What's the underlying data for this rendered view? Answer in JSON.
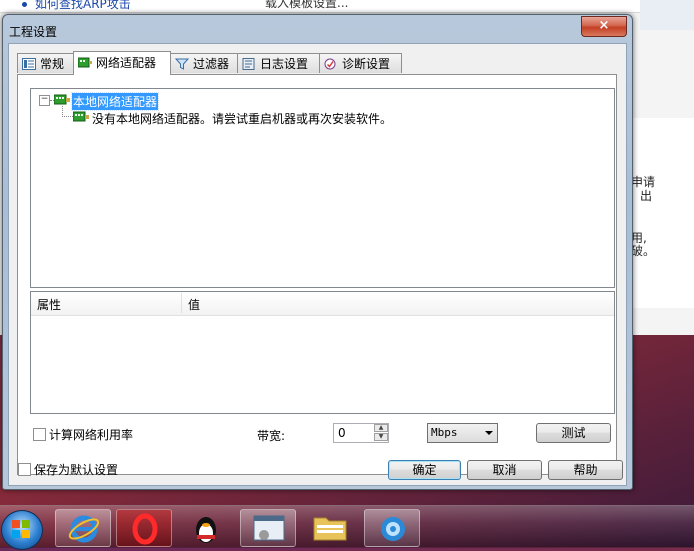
{
  "background_app": {
    "link_text": "如何查找ARP攻击",
    "tab_text": "载入模板设置...",
    "right_text_1": "申请",
    "right_text_2": "出",
    "right_text_3": "用,",
    "right_text_4": "破。"
  },
  "dialog": {
    "title": "工程设置",
    "close_symbol": "×",
    "tabs": [
      {
        "label": "常规",
        "icon": "list-icon",
        "active": false
      },
      {
        "label": "网络适配器",
        "icon": "network-adapter-icon",
        "active": true
      },
      {
        "label": "过滤器",
        "icon": "filter-funnel-icon",
        "active": false
      },
      {
        "label": "日志设置",
        "icon": "log-icon",
        "active": false
      },
      {
        "label": "诊断设置",
        "icon": "diagnose-icon",
        "active": false
      }
    ],
    "tree": {
      "expander": "−",
      "root_label": "本地网络适配器",
      "child_label": "没有本地网络适配器。请尝试重启机器或再次安装软件。"
    },
    "property_list": {
      "columns": [
        "属性",
        "值"
      ]
    },
    "calc_utilization_label": "计算网络利用率",
    "calc_utilization_checked": false,
    "bandwidth_label": "带宽:",
    "bandwidth_value": "0",
    "unit_selected": "Mbps",
    "test_button": "测试",
    "save_default_label": "保存为默认设置",
    "save_default_checked": false,
    "ok_button": "确定",
    "cancel_button": "取消",
    "help_button": "帮助"
  },
  "taskbar": {
    "items": [
      {
        "name": "start-orb-icon"
      },
      {
        "name": "internet-explorer-icon"
      },
      {
        "name": "opera-icon"
      },
      {
        "name": "qq-penguin-icon"
      },
      {
        "name": "control-panel-icon"
      },
      {
        "name": "folder-icon"
      },
      {
        "name": "network-app-icon"
      }
    ]
  },
  "colors": {
    "selection": "#3399ff",
    "dialog_frame": "#b9c9dc",
    "close_button": "#c33f24"
  }
}
